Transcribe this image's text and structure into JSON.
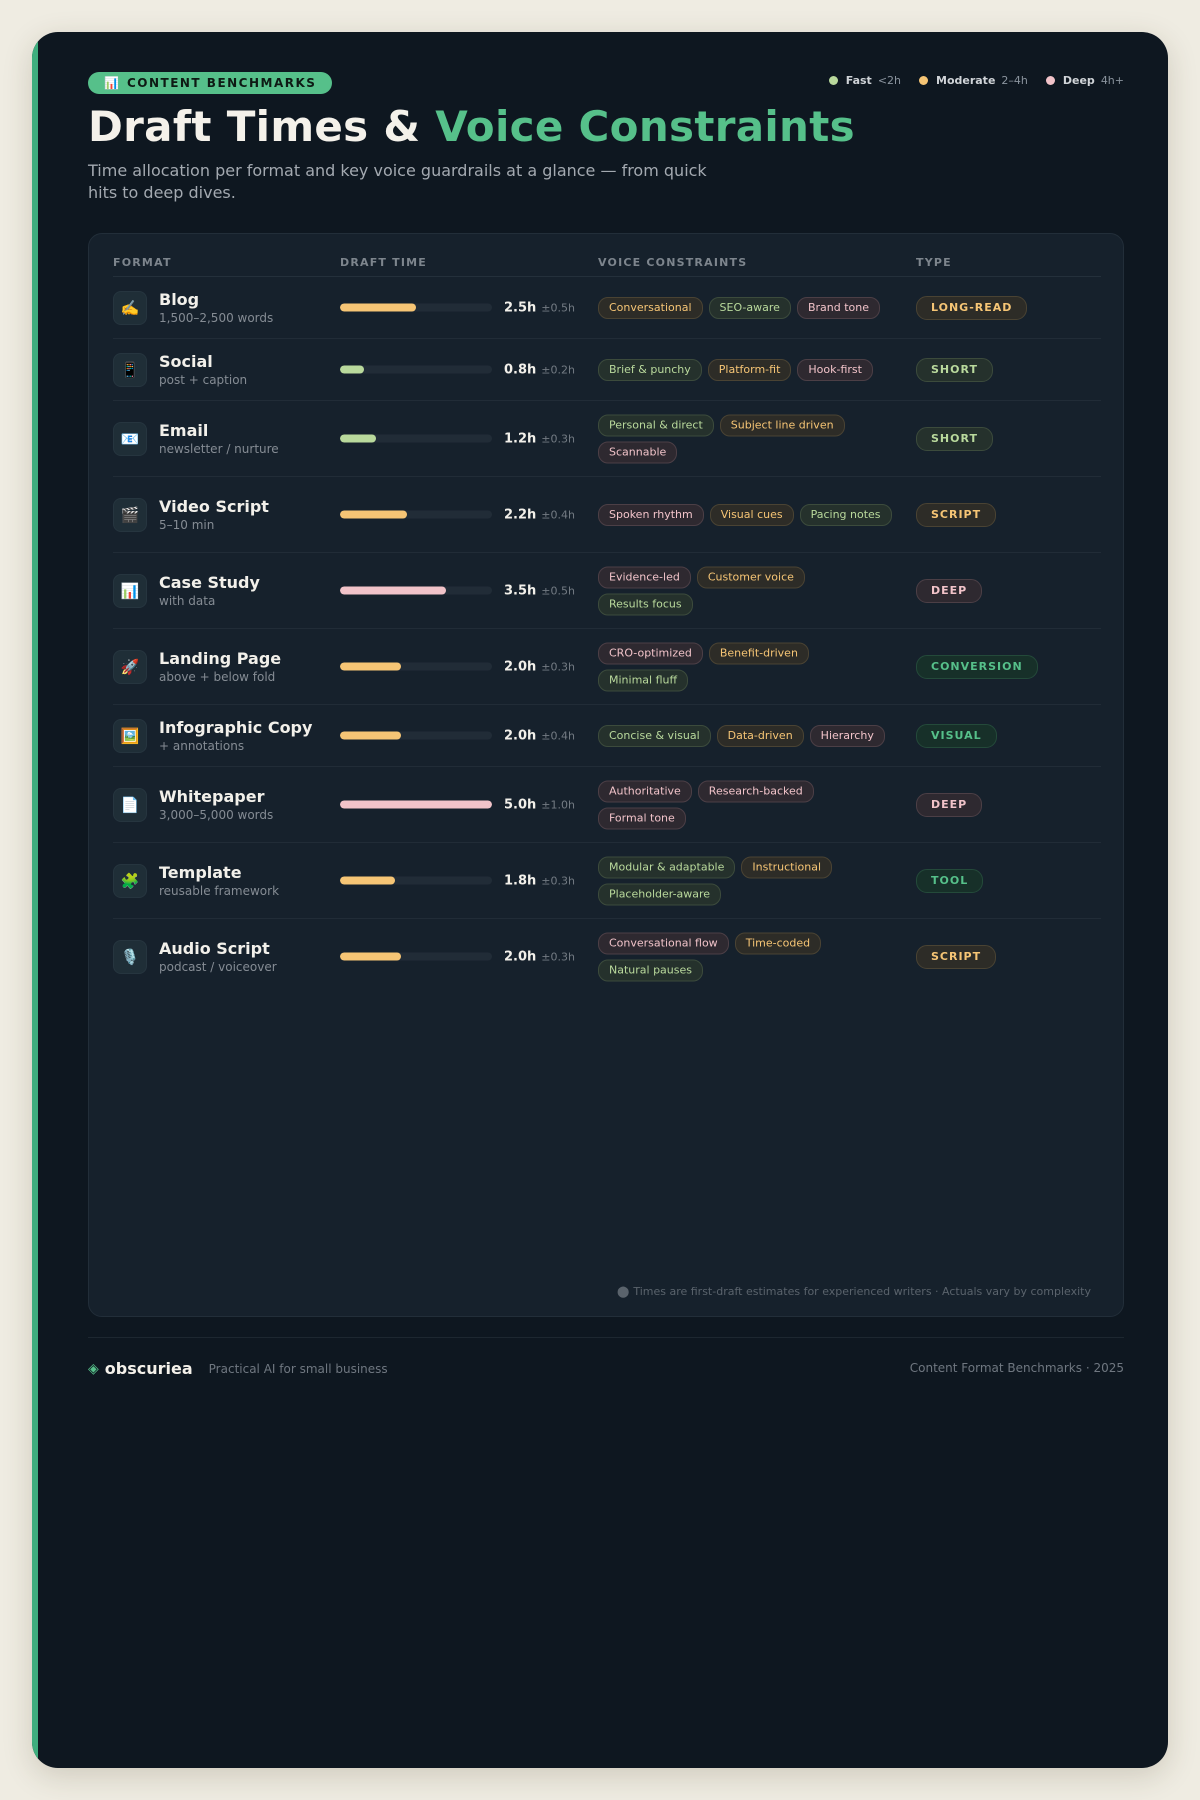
{
  "header": {
    "badge_icon": "📊",
    "badge_label": "CONTENT BENCHMARKS",
    "title_main": "Draft Times &",
    "title_accent": "Voice Constraints",
    "subtitle": "Time allocation per format and key voice guardrails at a glance — from quick hits to deep dives."
  },
  "legend": [
    {
      "name": "Fast",
      "range": "<2h",
      "color": "#b9d99c"
    },
    {
      "name": "Moderate",
      "range": "2–4h",
      "color": "#f6c575"
    },
    {
      "name": "Deep",
      "range": "4h+",
      "color": "#f1c3c9"
    }
  ],
  "table": {
    "headers": {
      "format": "FORMAT",
      "draft": "DRAFT TIME",
      "voice": "VOICE CONSTRAINTS",
      "type": "TYPE"
    },
    "max_hours": 5.0,
    "rows": [
      {
        "icon": "✍️",
        "icon_name": "writing-hand-icon",
        "name": "Blog",
        "sub": "1,500–2,500 words",
        "hours": 2.5,
        "time": "2.5h",
        "variance": "±0.5h",
        "speed": "amber",
        "tags": [
          {
            "label": "Conversational",
            "tone": "amber"
          },
          {
            "label": "SEO-aware",
            "tone": "green"
          },
          {
            "label": "Brand tone",
            "tone": "pink"
          }
        ],
        "type": "LONG-READ",
        "type_tone": "amber"
      },
      {
        "icon": "📱",
        "icon_name": "mobile-phone-icon",
        "name": "Social",
        "sub": "post + caption",
        "hours": 0.8,
        "time": "0.8h",
        "variance": "±0.2h",
        "speed": "green",
        "tags": [
          {
            "label": "Brief & punchy",
            "tone": "green"
          },
          {
            "label": "Platform-fit",
            "tone": "amber"
          },
          {
            "label": "Hook-first",
            "tone": "pink"
          }
        ],
        "type": "SHORT",
        "type_tone": "green"
      },
      {
        "icon": "📧",
        "icon_name": "email-icon",
        "name": "Email",
        "sub": "newsletter / nurture",
        "hours": 1.2,
        "time": "1.2h",
        "variance": "±0.3h",
        "speed": "green",
        "tags": [
          {
            "label": "Personal & direct",
            "tone": "green"
          },
          {
            "label": "Subject line driven",
            "tone": "amber"
          },
          {
            "label": "Scannable",
            "tone": "pink"
          }
        ],
        "type": "SHORT",
        "type_tone": "green"
      },
      {
        "icon": "🎬",
        "icon_name": "clapper-board-icon",
        "name": "Video Script",
        "sub": "5–10 min",
        "hours": 2.2,
        "time": "2.2h",
        "variance": "±0.4h",
        "speed": "amber",
        "tags": [
          {
            "label": "Spoken rhythm",
            "tone": "pink"
          },
          {
            "label": "Visual cues",
            "tone": "amber"
          },
          {
            "label": "Pacing notes",
            "tone": "green"
          }
        ],
        "type": "SCRIPT",
        "type_tone": "amber"
      },
      {
        "icon": "📊",
        "icon_name": "bar-chart-icon",
        "name": "Case Study",
        "sub": "with data",
        "hours": 3.5,
        "time": "3.5h",
        "variance": "±0.5h",
        "speed": "pink",
        "tags": [
          {
            "label": "Evidence-led",
            "tone": "pink"
          },
          {
            "label": "Customer voice",
            "tone": "amber"
          },
          {
            "label": "Results focus",
            "tone": "green"
          }
        ],
        "type": "DEEP",
        "type_tone": "pink"
      },
      {
        "icon": "🚀",
        "icon_name": "rocket-icon",
        "name": "Landing Page",
        "sub": "above + below fold",
        "hours": 2.0,
        "time": "2.0h",
        "variance": "±0.3h",
        "speed": "amber",
        "tags": [
          {
            "label": "CRO-optimized",
            "tone": "pink"
          },
          {
            "label": "Benefit-driven",
            "tone": "amber"
          },
          {
            "label": "Minimal fluff",
            "tone": "green"
          }
        ],
        "type": "CONVERSION",
        "type_tone": "teal"
      },
      {
        "icon": "🖼️",
        "icon_name": "framed-picture-icon",
        "name": "Infographic Copy",
        "sub": "+ annotations",
        "hours": 2.0,
        "time": "2.0h",
        "variance": "±0.4h",
        "speed": "amber",
        "tags": [
          {
            "label": "Concise & visual",
            "tone": "green"
          },
          {
            "label": "Data-driven",
            "tone": "amber"
          },
          {
            "label": "Hierarchy",
            "tone": "pink"
          }
        ],
        "type": "VISUAL",
        "type_tone": "teal"
      },
      {
        "icon": "📄",
        "icon_name": "document-icon",
        "name": "Whitepaper",
        "sub": "3,000–5,000 words",
        "hours": 5.0,
        "time": "5.0h",
        "variance": "±1.0h",
        "speed": "pink",
        "tags": [
          {
            "label": "Authoritative",
            "tone": "pink"
          },
          {
            "label": "Research-backed",
            "tone": "pink"
          },
          {
            "label": "Formal tone",
            "tone": "pink"
          }
        ],
        "type": "DEEP",
        "type_tone": "pink"
      },
      {
        "icon": "🧩",
        "icon_name": "puzzle-piece-icon",
        "name": "Template",
        "sub": "reusable framework",
        "hours": 1.8,
        "time": "1.8h",
        "variance": "±0.3h",
        "speed": "amber",
        "tags": [
          {
            "label": "Modular & adaptable",
            "tone": "green"
          },
          {
            "label": "Instructional",
            "tone": "amber"
          },
          {
            "label": "Placeholder-aware",
            "tone": "green"
          }
        ],
        "type": "TOOL",
        "type_tone": "teal"
      },
      {
        "icon": "🎙️",
        "icon_name": "microphone-icon",
        "name": "Audio Script",
        "sub": "podcast / voiceover",
        "hours": 2.0,
        "time": "2.0h",
        "variance": "±0.3h",
        "speed": "amber",
        "tags": [
          {
            "label": "Conversational flow",
            "tone": "pink"
          },
          {
            "label": "Time-coded",
            "tone": "amber"
          },
          {
            "label": "Natural pauses",
            "tone": "green"
          }
        ],
        "type": "SCRIPT",
        "type_tone": "amber"
      }
    ]
  },
  "footnote": {
    "icon": "⬤",
    "text": "Times are first-draft estimates for experienced writers · Actuals vary by complexity"
  },
  "footer": {
    "brand_mark": "◈",
    "brand_name": "obscuriea",
    "tagline": "Practical AI for small business",
    "right_text": "Content Format Benchmarks · 2025"
  },
  "colors": {
    "green": "#b9d99c",
    "amber": "#f6c575",
    "pink": "#f1c3c9",
    "brand": "#56c08a"
  }
}
